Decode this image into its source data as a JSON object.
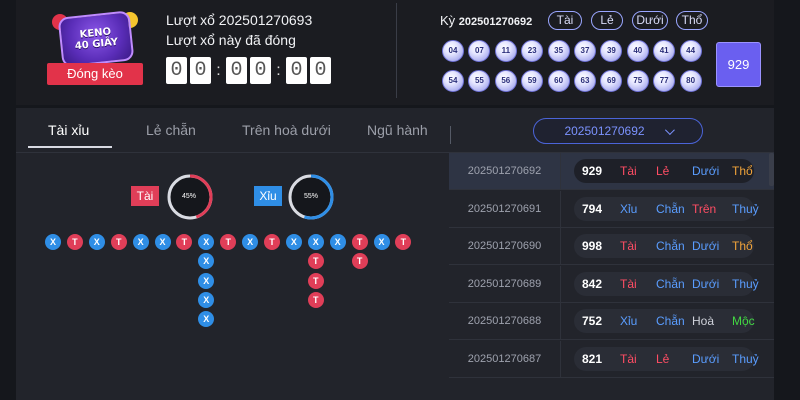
{
  "header": {
    "logo": {
      "line1": "KENO",
      "line2": "40 GIÂY"
    },
    "close_button": "Đóng kèo",
    "draw_title": "Lượt xổ 202501270693",
    "draw_status": "Lượt xổ này đã đóng",
    "countdown": [
      "0",
      "0",
      "0",
      "0",
      "0",
      "0"
    ]
  },
  "result": {
    "period_label": "Kỳ",
    "period_id": "202501270692",
    "chips": [
      "Tài",
      "Lẻ",
      "Dưới",
      "Thổ"
    ],
    "balls_row1": [
      "04",
      "07",
      "11",
      "23",
      "35",
      "37",
      "39",
      "40",
      "41",
      "44"
    ],
    "balls_row2": [
      "54",
      "55",
      "56",
      "59",
      "60",
      "63",
      "69",
      "75",
      "77",
      "80"
    ],
    "total": "929"
  },
  "tabs": [
    "Tài xỉu",
    "Lẻ chẵn",
    "Trên hoà dưới",
    "Ngũ hành"
  ],
  "period_select": "202501270692",
  "stats": {
    "tai_label": "Tài",
    "tai_pct": "45%",
    "tai_value": 0.45,
    "xiu_label": "Xỉu",
    "xiu_pct": "55%",
    "xiu_value": 0.55
  },
  "trend": [
    [
      "X"
    ],
    [
      "T"
    ],
    [
      "X"
    ],
    [
      "T"
    ],
    [
      "X"
    ],
    [
      "X"
    ],
    [
      "T"
    ],
    [
      "X",
      "X",
      "X",
      "X",
      "X"
    ],
    [
      "T"
    ],
    [
      "X"
    ],
    [
      "T"
    ],
    [
      "X"
    ],
    [
      "X",
      "T",
      "T",
      "T"
    ],
    [
      "X"
    ],
    [
      "T",
      "T"
    ],
    [
      "X"
    ],
    [
      "T"
    ]
  ],
  "history": [
    {
      "id": "202501270692",
      "sum": "929",
      "r": [
        "Tài",
        "Lẻ",
        "Dưới",
        "Thổ"
      ],
      "c": [
        "#ff4d64",
        "#ff4d64",
        "#5a9dff",
        "#f2a43a"
      ],
      "selected": true
    },
    {
      "id": "202501270691",
      "sum": "794",
      "r": [
        "Xỉu",
        "Chẵn",
        "Trên",
        "Thuỷ"
      ],
      "c": [
        "#5a9dff",
        "#5a9dff",
        "#ff4d64",
        "#5a9dff"
      ]
    },
    {
      "id": "202501270690",
      "sum": "998",
      "r": [
        "Tài",
        "Chẵn",
        "Dưới",
        "Thổ"
      ],
      "c": [
        "#ff4d64",
        "#5a9dff",
        "#5a9dff",
        "#f2a43a"
      ]
    },
    {
      "id": "202501270689",
      "sum": "842",
      "r": [
        "Tài",
        "Chẵn",
        "Dưới",
        "Thuỷ"
      ],
      "c": [
        "#ff4d64",
        "#5a9dff",
        "#5a9dff",
        "#5a9dff"
      ]
    },
    {
      "id": "202501270688",
      "sum": "752",
      "r": [
        "Xỉu",
        "Chẵn",
        "Hoà",
        "Mộc"
      ],
      "c": [
        "#5a9dff",
        "#5a9dff",
        "#cfd2da",
        "#43d843"
      ]
    },
    {
      "id": "202501270687",
      "sum": "821",
      "r": [
        "Tài",
        "Lẻ",
        "Dưới",
        "Thuỷ"
      ],
      "c": [
        "#ff4d64",
        "#ff4d64",
        "#5a9dff",
        "#5a9dff"
      ]
    }
  ],
  "colors": {
    "tai": "#e03e58",
    "xiu": "#2f8ee6",
    "accent": "#6a5ff0"
  }
}
